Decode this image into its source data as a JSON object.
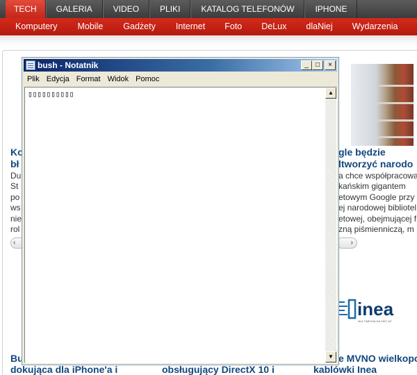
{
  "site": {
    "top_tabs": [
      {
        "label": "TECH",
        "active": true
      },
      {
        "label": "GALERIA",
        "active": false
      },
      {
        "label": "VIDEO",
        "active": false
      },
      {
        "label": "PLIKI",
        "active": false
      },
      {
        "label": "KATALOG TELEFONÓW",
        "active": false
      },
      {
        "label": "IPHONE",
        "active": false
      }
    ],
    "sub_nav": [
      "Komputery",
      "Mobile",
      "Gadżety",
      "Internet",
      "Foto",
      "DeLux",
      "dlaNiej",
      "Wydarzenia"
    ],
    "articles_left": {
      "headline": [
        "Ko",
        "bł"
      ],
      "snippet": [
        "Du",
        "St",
        "po",
        "ws",
        "nie",
        "rol"
      ]
    },
    "articles_right": {
      "headline": [
        "gle będzie",
        "ltworzyć narodo"
      ],
      "snippet": [
        "a chce współpracowa",
        "kańskim gigantem",
        "etowym Google przy t",
        "ej narodowej bibliotel",
        "etowej, obejmującej f",
        "zną piśmienniczą, m"
      ]
    },
    "bottom_headlines": [
      {
        "lines": [
          "Bu",
          "dokująca dla iPhone'a i"
        ]
      },
      {
        "lines": [
          "obsługujący DirectX 10 i"
        ]
      },
      {
        "lines": [
          "e MVNO wielkopo",
          "kablówki Inea"
        ]
      }
    ],
    "inea_logo_text": "inea",
    "inea_tagline": "MULTIMEDIALNA SIEĆ AP",
    "pager_arrow": "›",
    "pager_left_label": "‹",
    "pager_right_label": "›"
  },
  "notepad": {
    "title": "bush - Notatnik",
    "menu": [
      "Plik",
      "Edycja",
      "Format",
      "Widok",
      "Pomoc"
    ],
    "content": "▯▯▯▯▯▯▯▯▯▯",
    "buttons": {
      "minimize": "_",
      "maximize": "□",
      "close": "×"
    },
    "scroll": {
      "up": "▲",
      "down": "▼"
    }
  },
  "colors": {
    "accent_red": "#c52619",
    "title_blue": "#0a246a",
    "link_blue": "#11477e"
  }
}
